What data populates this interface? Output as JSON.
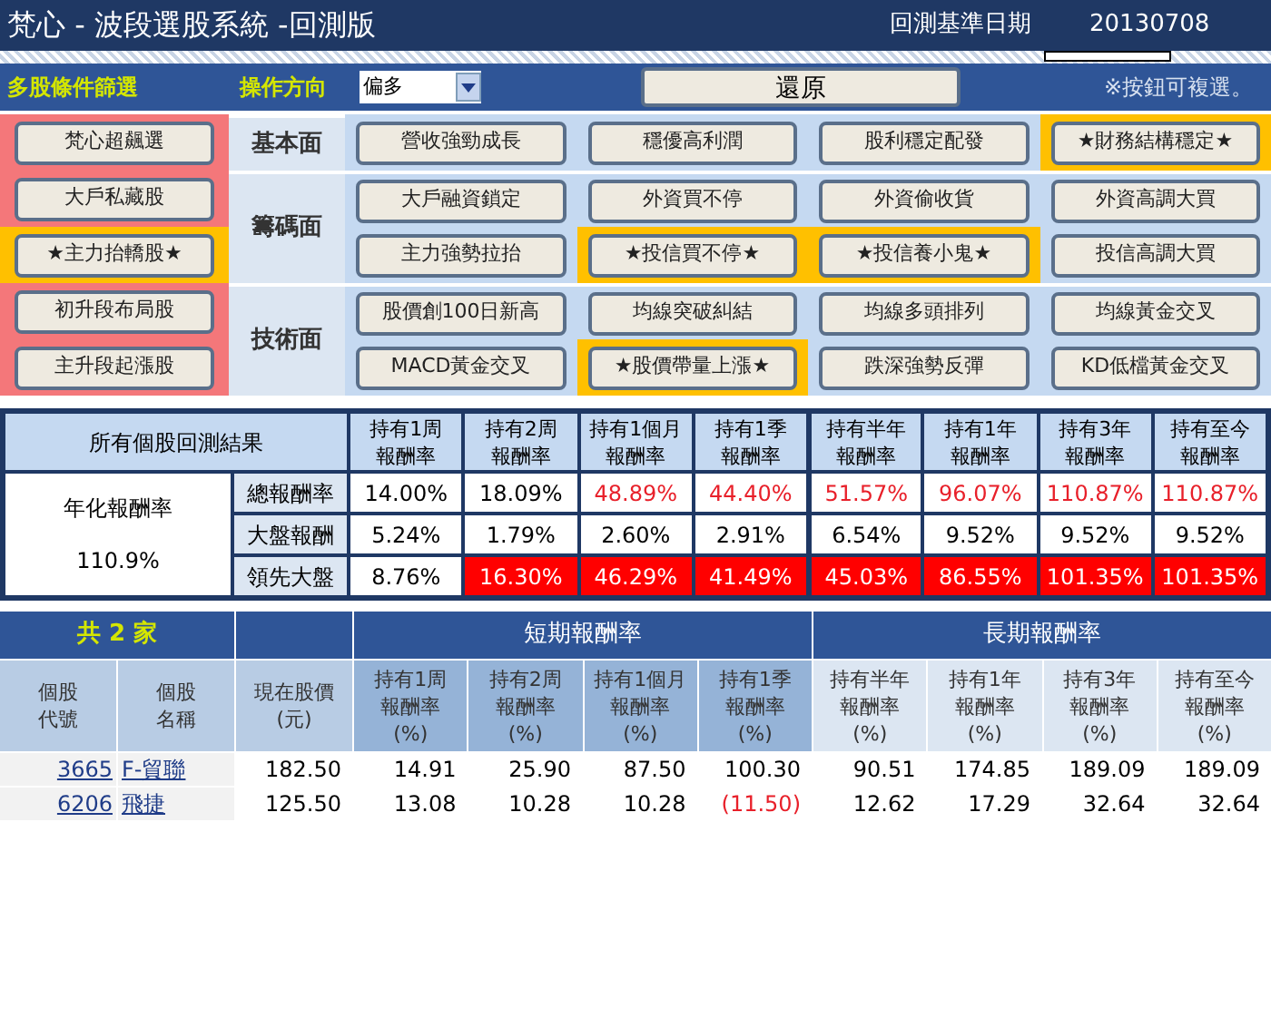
{
  "header": {
    "title": "梵心 - 波段選股系統 -回測版",
    "date_label": "回測基準日期",
    "date": "20130708"
  },
  "toolbar": {
    "filter_label": "多股條件篩選",
    "direction_label": "操作方向",
    "direction_value": "偏多",
    "reset_button": "還原",
    "hint": "※按鈕可複選。"
  },
  "strategy_rows": [
    {
      "left": {
        "label": "梵心超飆選",
        "selected": false
      },
      "category": "基本面",
      "buttons": [
        {
          "label": "營收強勁成長",
          "selected": false
        },
        {
          "label": "穩優高利潤",
          "selected": false
        },
        {
          "label": "股利穩定配發",
          "selected": false
        },
        {
          "label": "★財務結構穩定★",
          "selected": true
        }
      ]
    },
    {
      "left": {
        "label": "大戶私藏股",
        "selected": false
      },
      "category": "籌碼面",
      "buttons": [
        {
          "label": "大戶融資鎖定",
          "selected": false
        },
        {
          "label": "外資買不停",
          "selected": false
        },
        {
          "label": "外資偷收貨",
          "selected": false
        },
        {
          "label": "外資高調大買",
          "selected": false
        }
      ]
    },
    {
      "left": {
        "label": "★主力抬轎股★",
        "selected": true
      },
      "buttons": [
        {
          "label": "主力強勢拉抬",
          "selected": false
        },
        {
          "label": "★投信買不停★",
          "selected": true
        },
        {
          "label": "★投信養小鬼★",
          "selected": true
        },
        {
          "label": "投信高調大買",
          "selected": false
        }
      ]
    },
    {
      "left": {
        "label": "初升段布局股",
        "selected": false
      },
      "category": "技術面",
      "buttons": [
        {
          "label": "股價創100日新高",
          "selected": false
        },
        {
          "label": "均線突破糾結",
          "selected": false
        },
        {
          "label": "均線多頭排列",
          "selected": false
        },
        {
          "label": "均線黃金交叉",
          "selected": false
        }
      ]
    },
    {
      "left": {
        "label": "主升段起漲股",
        "selected": false
      },
      "buttons": [
        {
          "label": "MACD黃金交叉",
          "selected": false
        },
        {
          "label": "★股價帶量上漲★",
          "selected": true
        },
        {
          "label": "跌深強勢反彈",
          "selected": false
        },
        {
          "label": "KD低檔黃金交叉",
          "selected": false
        }
      ]
    }
  ],
  "backtest": {
    "title": "所有個股回測結果",
    "annual_label": "年化報酬率",
    "annual_value": "110.9%",
    "columns": [
      {
        "lines": [
          "持有1周",
          "報酬率"
        ]
      },
      {
        "lines": [
          "持有2周",
          "報酬率"
        ]
      },
      {
        "lines": [
          "持有1個月",
          "報酬率"
        ]
      },
      {
        "lines": [
          "持有1季",
          "報酬率"
        ]
      },
      {
        "lines": [
          "持有半年",
          "報酬率"
        ]
      },
      {
        "lines": [
          "持有1年",
          "報酬率"
        ]
      },
      {
        "lines": [
          "持有3年",
          "報酬率"
        ]
      },
      {
        "lines": [
          "持有至今",
          "報酬率"
        ]
      }
    ],
    "rows": [
      {
        "label": "總報酬率",
        "cells": [
          {
            "value": "14.00%",
            "red_text": false,
            "red_fill": false
          },
          {
            "value": "18.09%",
            "red_text": false,
            "red_fill": false
          },
          {
            "value": "48.89%",
            "red_text": true,
            "red_fill": false
          },
          {
            "value": "44.40%",
            "red_text": true,
            "red_fill": false
          },
          {
            "value": "51.57%",
            "red_text": true,
            "red_fill": false
          },
          {
            "value": "96.07%",
            "red_text": true,
            "red_fill": false
          },
          {
            "value": "110.87%",
            "red_text": true,
            "red_fill": false
          },
          {
            "value": "110.87%",
            "red_text": true,
            "red_fill": false
          }
        ]
      },
      {
        "label": "大盤報酬",
        "cells": [
          {
            "value": "5.24%",
            "red_text": false,
            "red_fill": false
          },
          {
            "value": "1.79%",
            "red_text": false,
            "red_fill": false
          },
          {
            "value": "2.60%",
            "red_text": false,
            "red_fill": false
          },
          {
            "value": "2.91%",
            "red_text": false,
            "red_fill": false
          },
          {
            "value": "6.54%",
            "red_text": false,
            "red_fill": false
          },
          {
            "value": "9.52%",
            "red_text": false,
            "red_fill": false
          },
          {
            "value": "9.52%",
            "red_text": false,
            "red_fill": false
          },
          {
            "value": "9.52%",
            "red_text": false,
            "red_fill": false
          }
        ]
      },
      {
        "label": "領先大盤",
        "cells": [
          {
            "value": "8.76%",
            "red_text": false,
            "red_fill": false
          },
          {
            "value": "16.30%",
            "red_text": false,
            "red_fill": true
          },
          {
            "value": "46.29%",
            "red_text": false,
            "red_fill": true
          },
          {
            "value": "41.49%",
            "red_text": false,
            "red_fill": true
          },
          {
            "value": "45.03%",
            "red_text": false,
            "red_fill": true
          },
          {
            "value": "86.55%",
            "red_text": false,
            "red_fill": true
          },
          {
            "value": "101.35%",
            "red_text": false,
            "red_fill": true
          },
          {
            "value": "101.35%",
            "red_text": false,
            "red_fill": true
          }
        ]
      }
    ]
  },
  "stocks": {
    "count_label": "共 2 家",
    "columns": [
      {
        "lines": [
          "個股",
          "代號"
        ]
      },
      {
        "lines": [
          "個股",
          "名稱"
        ]
      },
      {
        "lines": [
          "現在股價",
          "(元)"
        ]
      }
    ],
    "short_term": {
      "label": "短期報酬率",
      "columns": [
        {
          "lines": [
            "持有1周",
            "報酬率",
            "(%)"
          ]
        },
        {
          "lines": [
            "持有2周",
            "報酬率",
            "(%)"
          ]
        },
        {
          "lines": [
            "持有1個月",
            "報酬率",
            "(%)"
          ]
        },
        {
          "lines": [
            "持有1季",
            "報酬率",
            "(%)"
          ]
        }
      ]
    },
    "long_term": {
      "label": "長期報酬率",
      "columns": [
        {
          "lines": [
            "持有半年",
            "報酬率",
            "(%)"
          ]
        },
        {
          "lines": [
            "持有1年",
            "報酬率",
            "(%)"
          ]
        },
        {
          "lines": [
            "持有3年",
            "報酬率",
            "(%)"
          ]
        },
        {
          "lines": [
            "持有至今",
            "報酬率",
            "(%)"
          ]
        }
      ]
    },
    "rows": [
      {
        "code": "3665",
        "name": "F-貿聯",
        "values": [
          {
            "value": "182.50",
            "negative": false
          },
          {
            "value": "14.91",
            "negative": false
          },
          {
            "value": "25.90",
            "negative": false
          },
          {
            "value": "87.50",
            "negative": false
          },
          {
            "value": "100.30",
            "negative": false
          },
          {
            "value": "90.51",
            "negative": false
          },
          {
            "value": "174.85",
            "negative": false
          },
          {
            "value": "189.09",
            "negative": false
          },
          {
            "value": "189.09",
            "negative": false
          }
        ]
      },
      {
        "code": "6206",
        "name": "飛捷",
        "values": [
          {
            "value": "125.50",
            "negative": false
          },
          {
            "value": "13.08",
            "negative": false
          },
          {
            "value": "10.28",
            "negative": false
          },
          {
            "value": "10.28",
            "negative": false
          },
          {
            "value": "(11.50)",
            "negative": true
          },
          {
            "value": "12.62",
            "negative": false
          },
          {
            "value": "17.29",
            "negative": false
          },
          {
            "value": "32.64",
            "negative": false
          },
          {
            "value": "32.64",
            "negative": false
          }
        ]
      }
    ]
  }
}
